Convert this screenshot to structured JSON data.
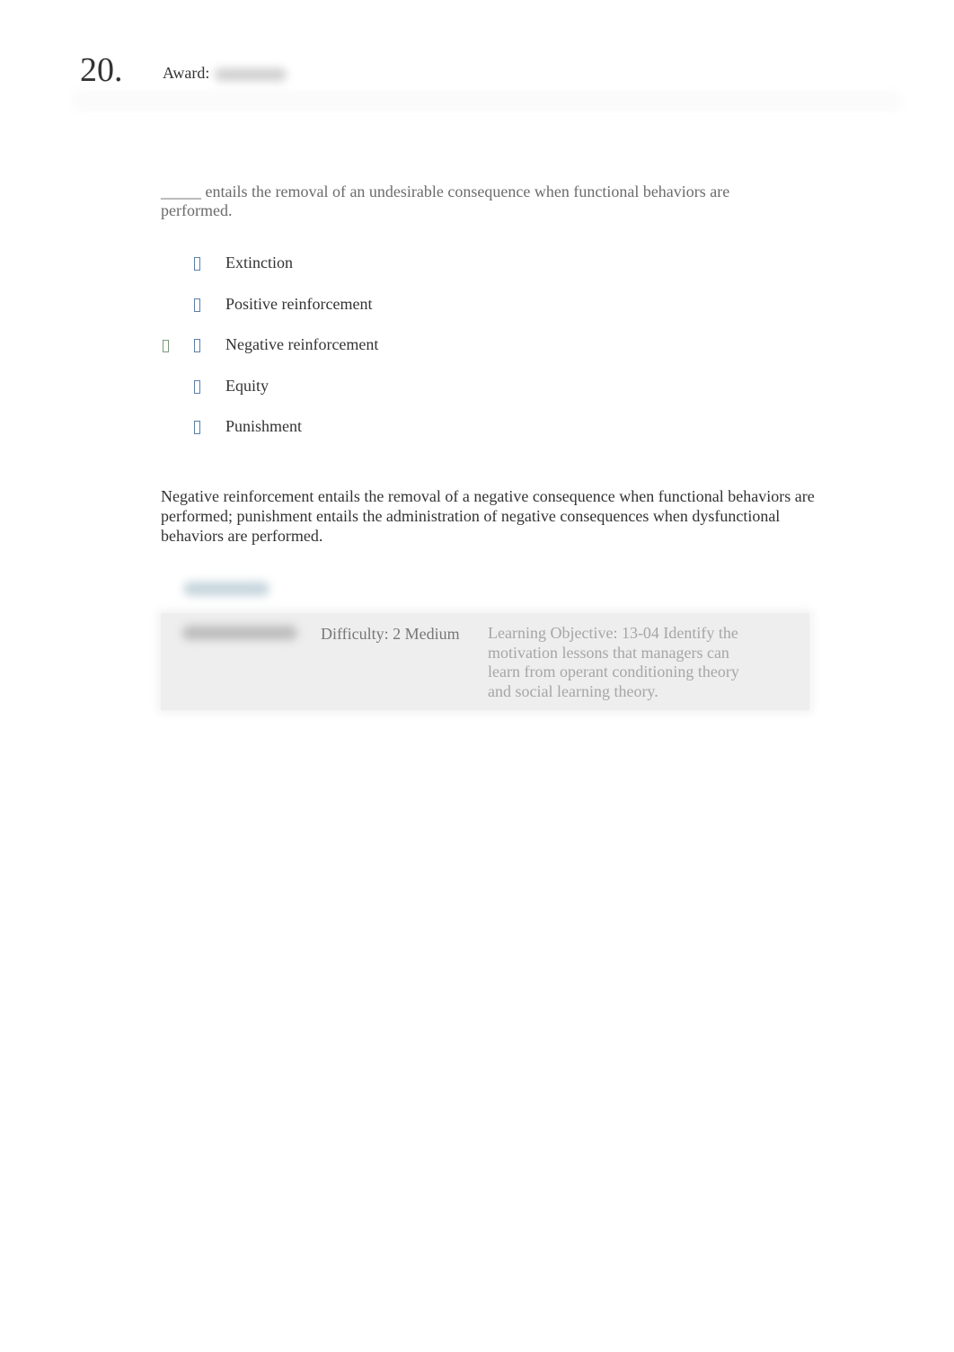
{
  "question": {
    "number": "20.",
    "award_label": "Award:",
    "award_value_redacted": true,
    "prompt": "_____ entails the removal of an undesirable consequence when functional behaviors are performed.",
    "choices": [
      {
        "label": "Extinction",
        "correct": false,
        "icon": "radio-icon"
      },
      {
        "label": "Positive reinforcement",
        "correct": false,
        "icon": "radio-icon"
      },
      {
        "label": "Negative reinforcement",
        "correct": true,
        "icon": "radio-icon",
        "marker_icon": "correct-check-icon"
      },
      {
        "label": "Equity",
        "correct": false,
        "icon": "radio-icon"
      },
      {
        "label": "Punishment",
        "correct": false,
        "icon": "radio-icon"
      }
    ],
    "explanation": "Negative reinforcement entails the removal of a negative consequence when functional behaviors are performed; punishment entails the administration of negative consequences when dysfunctional behaviors are performed."
  },
  "references": {
    "title_redacted": true,
    "tag_redacted": true,
    "difficulty": "Difficulty: 2 Medium",
    "learning_objective": "Learning Objective: 13-04 Identify the motivation lessons that managers can learn from operant conditioning theory and social learning theory."
  },
  "colors": {
    "correct_marker": "#7a9a7a",
    "radio": "#5a7fa8",
    "reference_bg": "#eeeeee"
  }
}
